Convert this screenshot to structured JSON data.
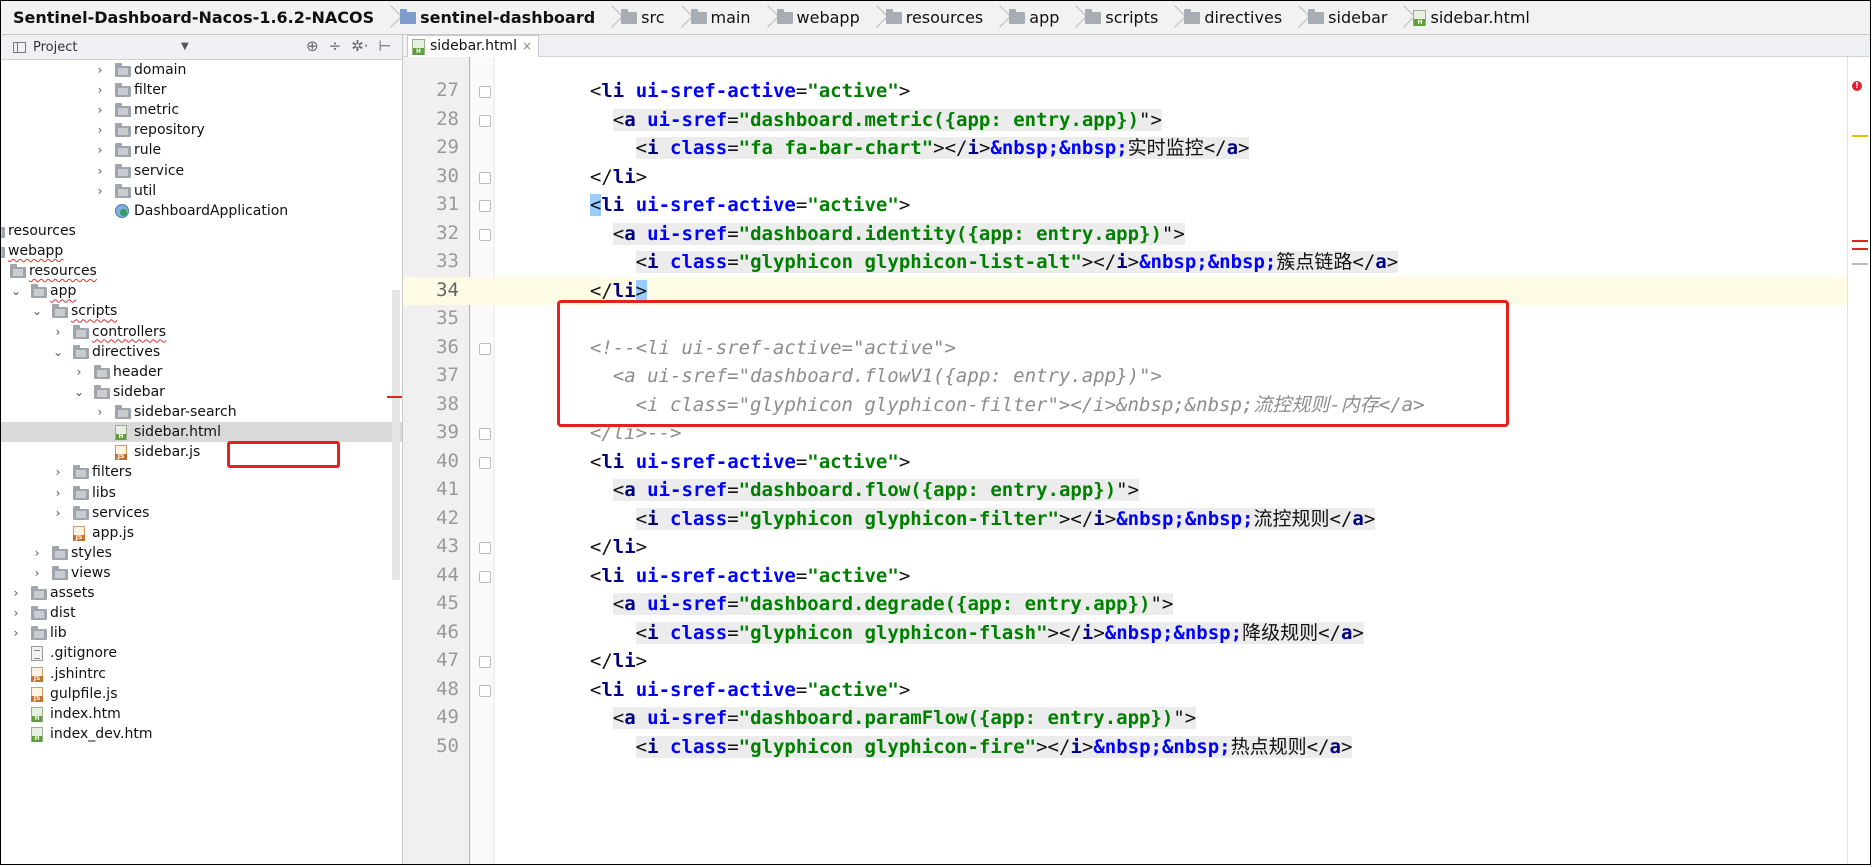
{
  "breadcrumb": [
    {
      "label": "Sentinel-Dashboard-Nacos-1.6.2-NACOS",
      "icon": "project-folder-icon",
      "bold": true
    },
    {
      "label": "sentinel-dashboard",
      "icon": "module-folder-icon",
      "bold": true
    },
    {
      "label": "src",
      "icon": "folder-icon"
    },
    {
      "label": "main",
      "icon": "folder-icon"
    },
    {
      "label": "webapp",
      "icon": "folder-icon"
    },
    {
      "label": "resources",
      "icon": "folder-icon"
    },
    {
      "label": "app",
      "icon": "folder-icon"
    },
    {
      "label": "scripts",
      "icon": "folder-icon"
    },
    {
      "label": "directives",
      "icon": "folder-icon"
    },
    {
      "label": "sidebar",
      "icon": "folder-icon"
    },
    {
      "label": "sidebar.html",
      "icon": "html-file-icon"
    }
  ],
  "project_panel": {
    "title": "Project",
    "tools": [
      "⊕",
      "÷",
      "✲·",
      "⊢"
    ]
  },
  "tree": [
    {
      "label": "domain",
      "type": "folder",
      "arrow": "›"
    },
    {
      "label": "filter",
      "type": "folder",
      "arrow": "›"
    },
    {
      "label": "metric",
      "type": "folder",
      "arrow": "›"
    },
    {
      "label": "repository",
      "type": "folder",
      "arrow": "›"
    },
    {
      "label": "rule",
      "type": "folder",
      "arrow": "›"
    },
    {
      "label": "service",
      "type": "folder",
      "arrow": "›"
    },
    {
      "label": "util",
      "type": "folder",
      "arrow": "›"
    },
    {
      "label": "DashboardApplication",
      "type": "app",
      "arrow": ""
    },
    {
      "label": "resources",
      "type": "folder",
      "arrow": "›"
    },
    {
      "label": "webapp",
      "type": "folder",
      "arrow": "⌄"
    },
    {
      "label": "resources",
      "type": "folder",
      "arrow": "⌄"
    },
    {
      "label": "app",
      "type": "folder",
      "arrow": "⌄"
    },
    {
      "label": "scripts",
      "type": "folder",
      "arrow": "⌄"
    },
    {
      "label": "controllers",
      "type": "folder",
      "arrow": "›"
    },
    {
      "label": "directives",
      "type": "folder",
      "arrow": "⌄"
    },
    {
      "label": "header",
      "type": "folder",
      "arrow": "›"
    },
    {
      "label": "sidebar",
      "type": "folder",
      "arrow": "⌄"
    },
    {
      "label": "sidebar-search",
      "type": "folder",
      "arrow": "›"
    },
    {
      "label": "sidebar.html",
      "type": "html",
      "arrow": ""
    },
    {
      "label": "sidebar.js",
      "type": "js",
      "arrow": ""
    },
    {
      "label": "filters",
      "type": "folder",
      "arrow": "›"
    },
    {
      "label": "libs",
      "type": "folder",
      "arrow": "›"
    },
    {
      "label": "services",
      "type": "folder",
      "arrow": "›"
    },
    {
      "label": "app.js",
      "type": "js",
      "arrow": ""
    },
    {
      "label": "styles",
      "type": "folder",
      "arrow": "›"
    },
    {
      "label": "views",
      "type": "folder",
      "arrow": "›"
    },
    {
      "label": "assets",
      "type": "folder",
      "arrow": "›"
    },
    {
      "label": "dist",
      "type": "folder",
      "arrow": "›"
    },
    {
      "label": "lib",
      "type": "folder",
      "arrow": "›"
    },
    {
      "label": ".gitignore",
      "type": "txt",
      "arrow": ""
    },
    {
      "label": ".jshintrc",
      "type": "js",
      "arrow": ""
    },
    {
      "label": "gulpfile.js",
      "type": "js",
      "arrow": ""
    },
    {
      "label": "index.htm",
      "type": "html",
      "arrow": ""
    },
    {
      "label": "index_dev.htm",
      "type": "html",
      "arrow": ""
    }
  ],
  "editor": {
    "tab_label": "sidebar.html",
    "tab_close": "×",
    "line_numbers": [
      "27",
      "28",
      "29",
      "30",
      "31",
      "32",
      "33",
      "34",
      "35",
      "36",
      "37",
      "38",
      "39",
      "40",
      "41",
      "42",
      "43",
      "44",
      "45",
      "46",
      "47",
      "48",
      "49",
      "50"
    ],
    "lines": [
      {
        "indent": "  ",
        "kind": "li_open"
      },
      {
        "indent": "    ",
        "kind": "a_open",
        "sref": "dashboard.metric({app: entry.app})"
      },
      {
        "indent": "      ",
        "kind": "i_line",
        "cls": "fa fa-bar-chart",
        "text": "实时监控"
      },
      {
        "indent": "  ",
        "kind": "li_close"
      },
      {
        "indent": "  ",
        "kind": "li_open_match"
      },
      {
        "indent": "    ",
        "kind": "a_open",
        "sref": "dashboard.identity({app: entry.app})"
      },
      {
        "indent": "      ",
        "kind": "i_line",
        "cls": "glyphicon glyphicon-list-alt",
        "text": "簇点链路"
      },
      {
        "indent": "  ",
        "kind": "li_close_match"
      },
      {
        "indent": "",
        "kind": "empty"
      },
      {
        "indent": "  ",
        "kind": "comment",
        "text": "<!--<li ui-sref-active=\"active\">"
      },
      {
        "indent": "    ",
        "kind": "comment",
        "text": "<a ui-sref=\"dashboard.flowV1({app: entry.app})\">"
      },
      {
        "indent": "      ",
        "kind": "comment",
        "text": "<i class=\"glyphicon glyphicon-filter\"></i>&nbsp;&nbsp;流控规则-内存</a>"
      },
      {
        "indent": "  ",
        "kind": "comment",
        "text": "</li>-->"
      },
      {
        "indent": "  ",
        "kind": "li_open"
      },
      {
        "indent": "    ",
        "kind": "a_open",
        "sref": "dashboard.flow({app: entry.app})"
      },
      {
        "indent": "      ",
        "kind": "i_line",
        "cls": "glyphicon glyphicon-filter",
        "text": "流控规则"
      },
      {
        "indent": "  ",
        "kind": "li_close"
      },
      {
        "indent": "  ",
        "kind": "li_open"
      },
      {
        "indent": "    ",
        "kind": "a_open",
        "sref": "dashboard.degrade({app: entry.app})"
      },
      {
        "indent": "      ",
        "kind": "i_line",
        "cls": "glyphicon glyphicon-flash",
        "text": "降级规则"
      },
      {
        "indent": "  ",
        "kind": "li_close"
      },
      {
        "indent": "  ",
        "kind": "li_open"
      },
      {
        "indent": "    ",
        "kind": "a_open",
        "sref": "dashboard.paramFlow({app: entry.app})"
      },
      {
        "indent": "      ",
        "kind": "i_line",
        "cls": "glyphicon glyphicon-fire",
        "text": "热点规则"
      }
    ],
    "tokens": {
      "li_tag": "li",
      "a_tag": "a",
      "i_tag": "i",
      "sref_active_attr": "ui-sref-active",
      "sref_attr": "ui-sref",
      "class_attr": "class",
      "active_value": "active",
      "nbsp": "&nbsp;"
    }
  },
  "colors": {
    "highlight_box": "#e3211f",
    "tag": "#000080",
    "attribute": "#0000ff",
    "value": "#008000",
    "comment": "#8c8c8c",
    "current_line": "#fffbe5"
  }
}
